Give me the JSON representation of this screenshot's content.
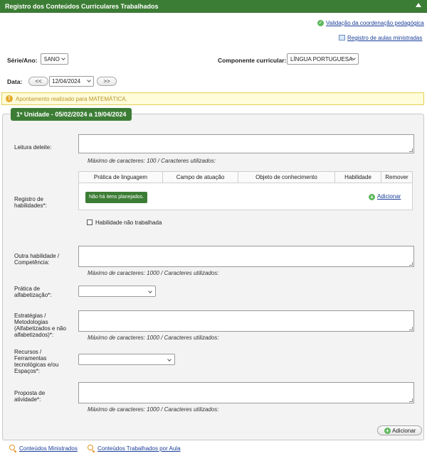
{
  "header": {
    "title": "Registro dos Conteúdos Curriculares Trabalhados"
  },
  "top_links": {
    "validation": "Validação da coordenação pedagógica",
    "register": "Registro de aulas ministradas"
  },
  "filters": {
    "serie_label": "Série/Ano:",
    "serie_value": "5ANO",
    "component_label": "Componente curricular:",
    "component_value": "LÍNGUA PORTUGUESA",
    "date_label": "Data:",
    "prev": "<<",
    "date_value": "12/04/2024",
    "next": ">>"
  },
  "notice": {
    "icon": "!",
    "text": "Apontamento realizado para MATEMÁTICA."
  },
  "unit": {
    "title": "1ª Unidade - 05/02/2024 a 19/04/2024"
  },
  "fields": {
    "leitura": {
      "label": "Leitura deleite:",
      "hint": "Máximo de caracteres: 100 / Caracteres utilizados:"
    },
    "registro": {
      "label": "Registro de habilidades*:"
    },
    "outra": {
      "label": "Outra habilidade / Competência:",
      "hint": "Máximo de caracteres: 1000 / Caracteres utilizados:"
    },
    "pratica": {
      "label": "Prática de alfabetização*:"
    },
    "estrategias": {
      "label": "Estratégias / Metodologias (Alfabetizados e não alfabetizados)*:",
      "hint": "Máximo de caracteres: 1000 / Caracteres utilizados:"
    },
    "recursos": {
      "label": "Recursos / Ferramentas tecnológicas e/ou Espaços*:"
    },
    "proposta": {
      "label": "Proposta de atividade*:",
      "hint": "Máximo de caracteres: 1000 / Caracteres utilizados:"
    }
  },
  "table": {
    "columns": [
      "Prática de linguagem",
      "Campo de atuação",
      "Objeto de conhecimento",
      "Habilidade",
      "Remover"
    ],
    "empty": "Não há itens planejados.",
    "add": "Adicionar"
  },
  "checkbox": {
    "label": "Habilidade não trabalhada"
  },
  "add_button": "Adicionar",
  "footer": {
    "link1": "Conteúdos Ministrados",
    "link2": "Conteúdos Trabalhados por Aula"
  }
}
